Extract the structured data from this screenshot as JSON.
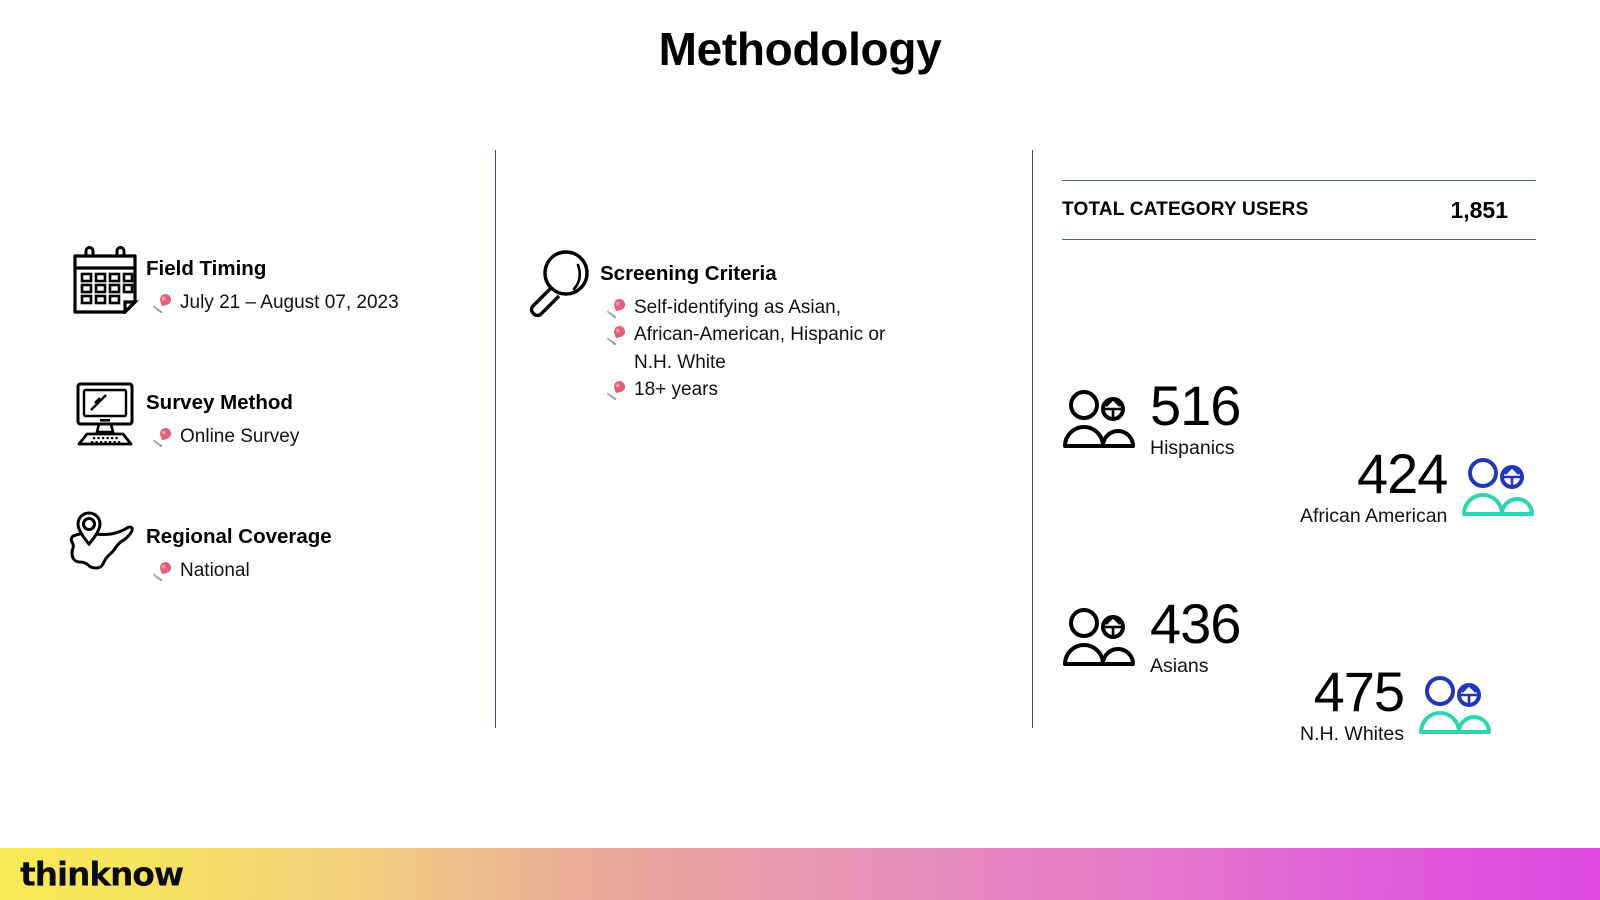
{
  "slide": {
    "title": "Methodology"
  },
  "left_column": {
    "items": [
      {
        "icon": "calendar-icon",
        "heading": "Field Timing",
        "bullets": [
          "July 21 – August 07, 2023"
        ]
      },
      {
        "icon": "desktop-computer-icon",
        "heading": "Survey Method",
        "bullets": [
          "Online Survey"
        ]
      },
      {
        "icon": "usa-map-pin-icon",
        "heading": "Regional Coverage",
        "bullets": [
          "National"
        ]
      }
    ]
  },
  "middle_column": {
    "items": [
      {
        "icon": "magnifying-glass-icon",
        "heading": "Screening Criteria",
        "bullets": [
          "Self-identifying as Asian,",
          "African-American, Hispanic or",
          "N.H. White",
          "18+ years"
        ],
        "bullets_with_pin": [
          true,
          true,
          false,
          true
        ]
      }
    ]
  },
  "right_column": {
    "total_label": "TOTAL CATEGORY USERS",
    "total_value": "1,851",
    "stats": [
      {
        "value": "516",
        "label": "Hispanics",
        "icon": "people-icon",
        "icon_style": "black",
        "icon_side": "left"
      },
      {
        "value": "424",
        "label": "African American",
        "icon": "people-icon-colored",
        "icon_style": "color",
        "icon_side": "right"
      },
      {
        "value": "436",
        "label": "Asians",
        "icon": "people-icon",
        "icon_style": "black",
        "icon_side": "left"
      },
      {
        "value": "475",
        "label": "N.H. Whites",
        "icon": "people-icon-colored",
        "icon_style": "color",
        "icon_side": "right"
      }
    ]
  },
  "footer": {
    "logo_text": "thinknow"
  },
  "colors": {
    "divider": "#3a5068",
    "rule": "#4a6785",
    "pin_head": "#e0607c",
    "icon_blue": "#2236b8",
    "icon_teal": "#2ed3b0",
    "text": "#000000",
    "footer_gradient_start": "#f7ea54",
    "footer_gradient_end": "#dd49dd"
  }
}
